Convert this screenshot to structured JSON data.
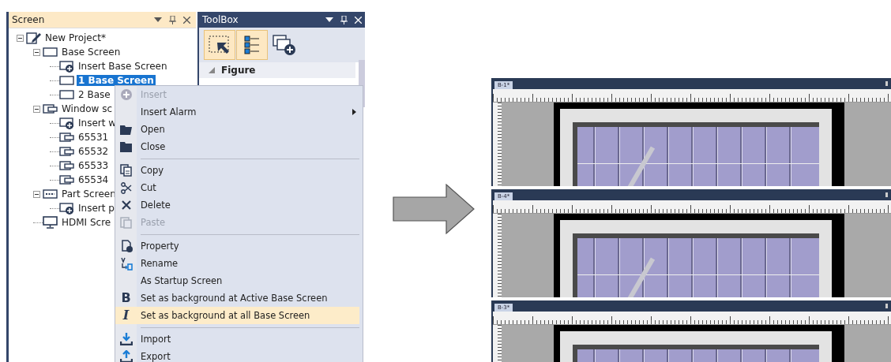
{
  "screen_panel": {
    "title": "Screen",
    "tree": [
      {
        "kind": "project",
        "label": "New Project*",
        "expanded": true,
        "selected": false,
        "children": [
          {
            "kind": "base",
            "label": "Base Screen",
            "expanded": true,
            "selected": false,
            "children": [
              {
                "kind": "insert",
                "label": "Insert Base Screen",
                "selected": false
              },
              {
                "kind": "base",
                "label": "1 Base Screen",
                "selected": true
              },
              {
                "kind": "base",
                "label": "2 Base",
                "selected": false
              }
            ]
          },
          {
            "kind": "window",
            "label": "Window sc",
            "expanded": true,
            "selected": false,
            "children": [
              {
                "kind": "insert",
                "label": "Insert w",
                "selected": false
              },
              {
                "kind": "window",
                "label": "65531",
                "selected": false
              },
              {
                "kind": "window",
                "label": "65532",
                "selected": false
              },
              {
                "kind": "window",
                "label": "65533",
                "selected": false
              },
              {
                "kind": "window",
                "label": "65534",
                "selected": false
              }
            ]
          },
          {
            "kind": "part",
            "label": "Part Screen",
            "expanded": true,
            "selected": false,
            "children": [
              {
                "kind": "insert",
                "label": "Insert p",
                "selected": false
              }
            ]
          },
          {
            "kind": "hdmi",
            "label": "HDMI Scre",
            "selected": false
          }
        ]
      }
    ]
  },
  "toolbox": {
    "title": "ToolBox",
    "tools": [
      {
        "selected": true
      },
      {
        "selected": true
      },
      {
        "selected": false
      }
    ],
    "section": {
      "title": "Figure",
      "expanded": true
    }
  },
  "context_menu": {
    "items": [
      {
        "kind": "item",
        "label": "Insert",
        "disabled": true,
        "selected": false
      },
      {
        "kind": "item",
        "label": "Insert Alarm",
        "disabled": false,
        "selected": false,
        "submenu": true
      },
      {
        "kind": "item",
        "label": "Open",
        "disabled": false,
        "selected": false
      },
      {
        "kind": "item",
        "label": "Close",
        "disabled": false,
        "selected": false
      },
      {
        "kind": "separator"
      },
      {
        "kind": "item",
        "label": "Copy",
        "disabled": false,
        "selected": false
      },
      {
        "kind": "item",
        "label": "Cut",
        "disabled": false,
        "selected": false
      },
      {
        "kind": "item",
        "label": "Delete",
        "disabled": false,
        "selected": false
      },
      {
        "kind": "item",
        "label": "Paste",
        "disabled": true,
        "selected": false
      },
      {
        "kind": "separator"
      },
      {
        "kind": "item",
        "label": "Property",
        "disabled": false,
        "selected": false
      },
      {
        "kind": "item",
        "label": "Rename",
        "disabled": false,
        "selected": false
      },
      {
        "kind": "item",
        "label": "As Startup Screen",
        "disabled": false,
        "selected": false
      },
      {
        "kind": "item",
        "label": "Set as background at Active Base Screen",
        "disabled": false,
        "selected": false,
        "icon_glyph": "B"
      },
      {
        "kind": "item",
        "label": "Set as background at all Base Screen",
        "disabled": false,
        "selected": true,
        "icon_glyph": "I"
      },
      {
        "kind": "separator"
      },
      {
        "kind": "item",
        "label": "Import",
        "disabled": false,
        "selected": false
      },
      {
        "kind": "item",
        "label": "Export",
        "disabled": false,
        "selected": false
      }
    ]
  },
  "editor_panes": [
    {
      "tab_label": "B-1*"
    },
    {
      "tab_label": "B-4*"
    },
    {
      "tab_label": "B-3*"
    }
  ]
}
